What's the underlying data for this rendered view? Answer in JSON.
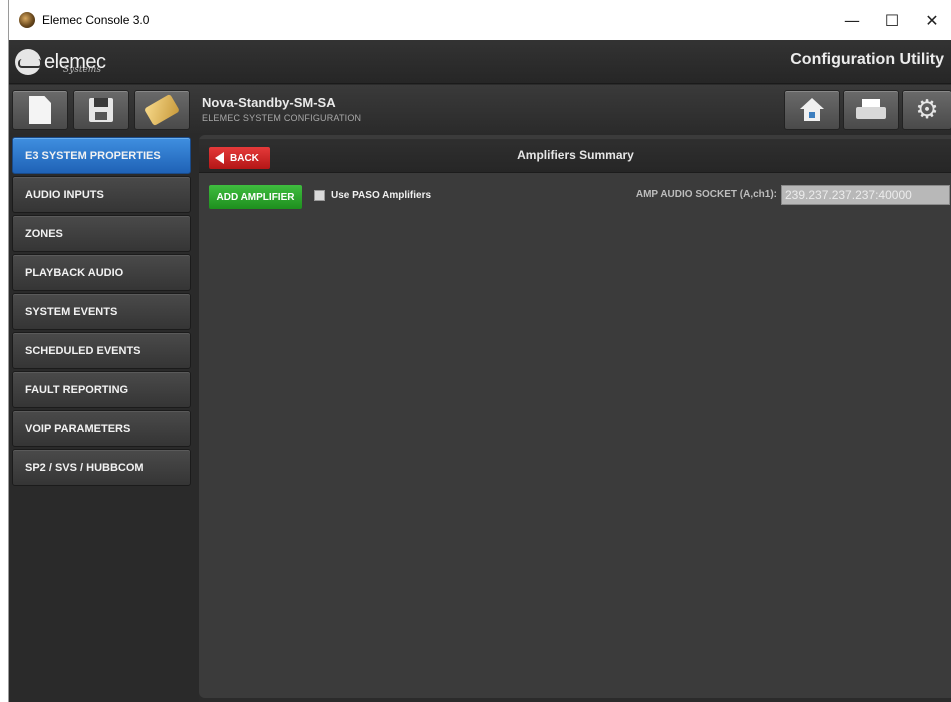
{
  "window": {
    "title": "Elemec Console 3.0",
    "controls": {
      "minimize": "—",
      "maximize": "☐",
      "close": "✕"
    }
  },
  "brand": {
    "logo_text": "elemec",
    "logo_sub": "Systems",
    "app_title": "Configuration Utility"
  },
  "toolbar": {
    "file_buttons": [
      "new-document-icon",
      "save-icon",
      "tag-icon"
    ],
    "document_title": "Nova-Standby-SM-SA",
    "document_subtitle": "ELEMEC SYSTEM CONFIGURATION",
    "right_buttons": [
      "home-icon",
      "printer-icon",
      "gear-icon"
    ]
  },
  "sidebar": {
    "items": [
      {
        "label": "E3 SYSTEM PROPERTIES",
        "active": true
      },
      {
        "label": "AUDIO INPUTS",
        "active": false
      },
      {
        "label": "ZONES",
        "active": false
      },
      {
        "label": "PLAYBACK AUDIO",
        "active": false
      },
      {
        "label": "SYSTEM EVENTS",
        "active": false
      },
      {
        "label": "SCHEDULED EVENTS",
        "active": false
      },
      {
        "label": "FAULT REPORTING",
        "active": false
      },
      {
        "label": "VOIP PARAMETERS",
        "active": false
      },
      {
        "label": "SP2 / SVS / HUBBCOM",
        "active": false
      }
    ]
  },
  "main": {
    "back_label": "BACK",
    "title": "Amplifiers Summary",
    "add_amplifier_label": "ADD AMPLIFIER",
    "use_paso_label": "Use PASO Amplifiers",
    "use_paso_checked": false,
    "socket_label": "AMP AUDIO SOCKET (A,ch1):",
    "socket_value": "239.237.237.237:40000"
  },
  "colors": {
    "active_nav": "#2a74cc",
    "back_button": "#cc2222",
    "add_button": "#2ea62e",
    "panel_bg": "#3b3b3b"
  }
}
